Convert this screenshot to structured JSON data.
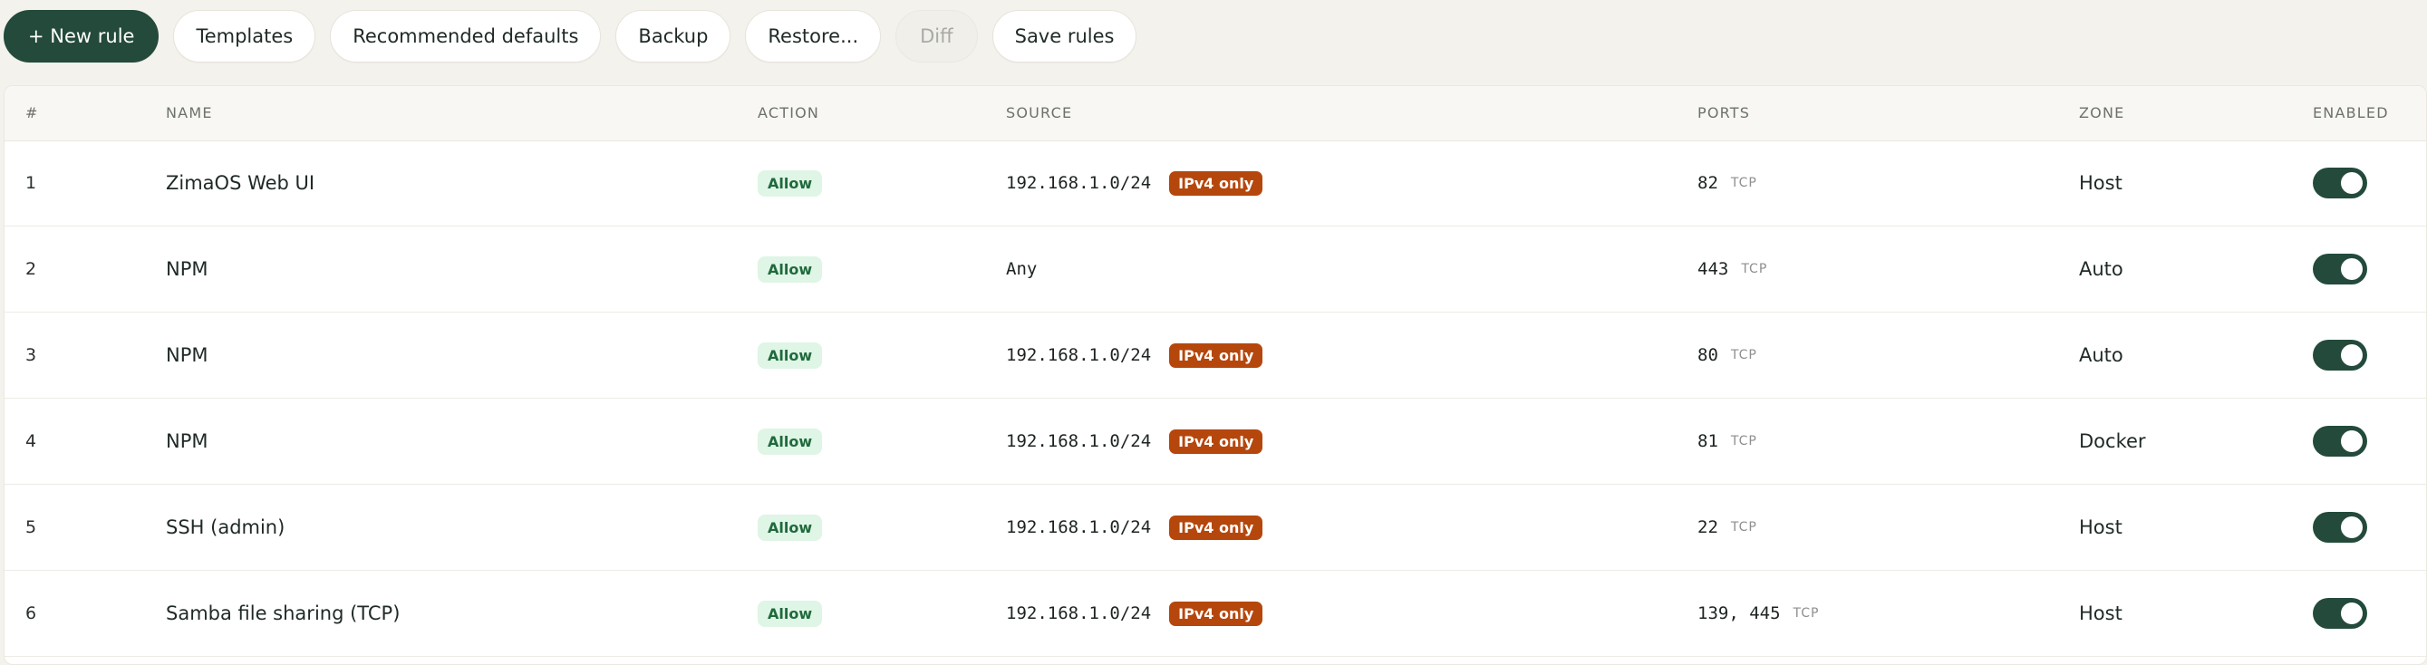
{
  "toolbar": {
    "new_rule": "+ New rule",
    "templates": "Templates",
    "recommended_defaults": "Recommended defaults",
    "backup": "Backup",
    "restore": "Restore...",
    "diff": "Diff",
    "save_rules": "Save rules"
  },
  "colors": {
    "primary": "#234a3b",
    "allow_bg": "#dff5e6",
    "allow_text": "#1f6a3c",
    "ipv4_badge": "#b5470d",
    "page_bg": "#f4f2ed"
  },
  "table": {
    "headers": {
      "num": "#",
      "name": "NAME",
      "action": "ACTION",
      "source": "SOURCE",
      "ports": "PORTS",
      "zone": "ZONE",
      "enabled": "ENABLED"
    },
    "rows": [
      {
        "num": "1",
        "name": "ZimaOS Web UI",
        "action": "Allow",
        "source": "192.168.1.0/24",
        "badge": "IPv4 only",
        "ports": "82",
        "proto": "TCP",
        "zone": "Host",
        "enabled": true
      },
      {
        "num": "2",
        "name": "NPM",
        "action": "Allow",
        "source": "Any",
        "badge": "",
        "ports": "443",
        "proto": "TCP",
        "zone": "Auto",
        "enabled": true
      },
      {
        "num": "3",
        "name": "NPM",
        "action": "Allow",
        "source": "192.168.1.0/24",
        "badge": "IPv4 only",
        "ports": "80",
        "proto": "TCP",
        "zone": "Auto",
        "enabled": true
      },
      {
        "num": "4",
        "name": "NPM",
        "action": "Allow",
        "source": "192.168.1.0/24",
        "badge": "IPv4 only",
        "ports": "81",
        "proto": "TCP",
        "zone": "Docker",
        "enabled": true
      },
      {
        "num": "5",
        "name": "SSH (admin)",
        "action": "Allow",
        "source": "192.168.1.0/24",
        "badge": "IPv4 only",
        "ports": "22",
        "proto": "TCP",
        "zone": "Host",
        "enabled": true
      },
      {
        "num": "6",
        "name": "Samba file sharing (TCP)",
        "action": "Allow",
        "source": "192.168.1.0/24",
        "badge": "IPv4 only",
        "ports": "139, 445",
        "proto": "TCP",
        "zone": "Host",
        "enabled": true
      }
    ]
  }
}
